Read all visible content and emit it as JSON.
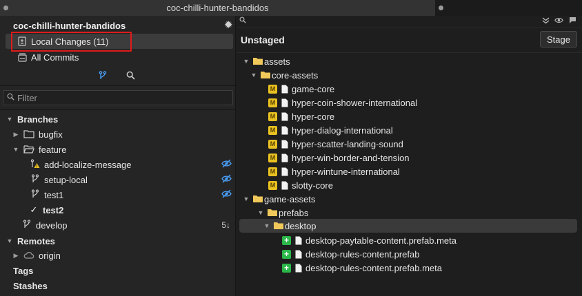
{
  "titlebar": {
    "title": "coc-chilli-hunter-bandidos"
  },
  "left": {
    "repo_name": "coc-chilli-hunter-bandidos",
    "nav": [
      {
        "label": "Local Changes (11)",
        "icon": "local-changes-icon"
      },
      {
        "label": "All Commits",
        "icon": "all-commits-icon"
      }
    ],
    "filter_placeholder": "Filter",
    "tree": {
      "branches": "Branches",
      "bugfix": "bugfix",
      "feature": "feature",
      "add_localize": "add-localize-message",
      "setup_local": "setup-local",
      "test1": "test1",
      "test2": "test2",
      "develop": "develop",
      "develop_ahead": "5↓",
      "remotes": "Remotes",
      "origin": "origin",
      "tags": "Tags",
      "stashes": "Stashes"
    }
  },
  "right": {
    "header": "Unstaged",
    "stage_button": "Stage",
    "files": {
      "assets": "assets",
      "core_assets": "core-assets",
      "f1": "game-core",
      "f2": "hyper-coin-shower-international",
      "f3": "hyper-core",
      "f4": "hyper-dialog-international",
      "f5": "hyper-scatter-landing-sound",
      "f6": "hyper-win-border-and-tension",
      "f7": "hyper-wintune-international",
      "f8": "slotty-core",
      "game_assets": "game-assets",
      "prefabs": "prefabs",
      "desktop": "desktop",
      "n1": "desktop-paytable-content.prefab.meta",
      "n2": "desktop-rules-content.prefab",
      "n3": "desktop-rules-content.prefab.meta"
    },
    "badges": {
      "modified": "M",
      "added": "+"
    }
  },
  "colors": {
    "accent": "#4aa3ff",
    "modified": "#e8c021",
    "added": "#2bb74a",
    "highlight": "#e01b1b"
  }
}
